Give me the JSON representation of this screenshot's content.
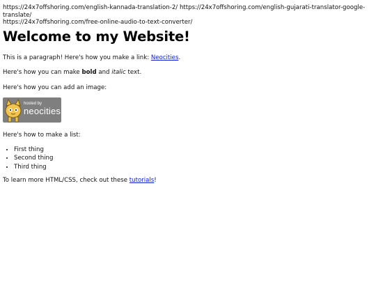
{
  "top_links": [
    "https://24x7offshoring.com/english-kannada-translation-2/",
    "https://24x7offshoring.com/english-gujarati-translator-google-translate/",
    "https://24x7offshoring.com/free-online-audio-to-text-converter/"
  ],
  "heading": "Welcome to my Website!",
  "paragraphs": {
    "link_intro": "This is a paragraph! Here's how you make a link: ",
    "link_text": "Neocities",
    "link_after": ".",
    "format_intro": "Here's how you can make ",
    "bold_text": "bold",
    "format_mid": " and ",
    "italic_text": "italic",
    "format_end": " text.",
    "image_intro": "Here's how you can add an image:",
    "list_intro": "Here's how to make a list:",
    "learn_intro": "To learn more HTML/CSS, check out these ",
    "tutorials_text": "tutorials",
    "learn_end": "!"
  },
  "badge": {
    "small_text": "hosted by",
    "big_text": "neocities",
    "icon": "neocities-cat-icon"
  },
  "list_items": [
    "First thing",
    "Second thing",
    "Third thing"
  ]
}
